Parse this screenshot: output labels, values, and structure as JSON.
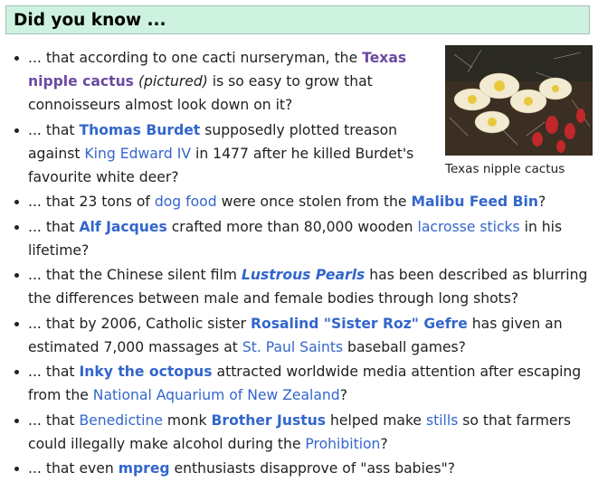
{
  "section": {
    "title": "Did you know ..."
  },
  "figure": {
    "caption": "Texas nipple cactus",
    "icon": "cactus-photo-image"
  },
  "hooks": [
    {
      "parts": [
        {
          "t": "... that according to one cacti nurseryman, the "
        },
        {
          "t": "Texas nipple cactus",
          "link": true,
          "bold": true,
          "visited": true
        },
        {
          "t": " "
        },
        {
          "t": "(pictured)",
          "italic": true
        },
        {
          "t": " is so easy to grow that connoisseurs almost look down on it?"
        }
      ]
    },
    {
      "parts": [
        {
          "t": "... that "
        },
        {
          "t": "Thomas Burdet",
          "link": true,
          "bold": true
        },
        {
          "t": " supposedly plotted treason against "
        },
        {
          "t": "King Edward IV",
          "link": true
        },
        {
          "t": " in 1477 after he killed Burdet's favourite white deer?"
        }
      ]
    },
    {
      "parts": [
        {
          "t": "... that 23 tons of "
        },
        {
          "t": "dog food",
          "link": true
        },
        {
          "t": " were once stolen from the "
        },
        {
          "t": "Malibu Feed Bin",
          "link": true,
          "bold": true
        },
        {
          "t": "?"
        }
      ]
    },
    {
      "parts": [
        {
          "t": "... that "
        },
        {
          "t": "Alf Jacques",
          "link": true,
          "bold": true
        },
        {
          "t": " crafted more than 80,000 wooden "
        },
        {
          "t": "lacrosse sticks",
          "link": true
        },
        {
          "t": " in his lifetime?"
        }
      ]
    },
    {
      "parts": [
        {
          "t": "... that the Chinese silent film "
        },
        {
          "t": "Lustrous Pearls",
          "link": true,
          "bold": true,
          "italic": true
        },
        {
          "t": " has been described as blurring the differences between male and female bodies through long shots?"
        }
      ]
    },
    {
      "parts": [
        {
          "t": "... that by 2006, Catholic sister "
        },
        {
          "t": "Rosalind \"Sister Roz\" Gefre",
          "link": true,
          "bold": true
        },
        {
          "t": " has given an estimated 7,000 massages at "
        },
        {
          "t": "St. Paul Saints",
          "link": true
        },
        {
          "t": " baseball games?"
        }
      ]
    },
    {
      "parts": [
        {
          "t": "... that "
        },
        {
          "t": "Inky the octopus",
          "link": true,
          "bold": true
        },
        {
          "t": " attracted worldwide media attention after escaping from the "
        },
        {
          "t": "National Aquarium of New Zealand",
          "link": true
        },
        {
          "t": "?"
        }
      ]
    },
    {
      "parts": [
        {
          "t": "... that "
        },
        {
          "t": "Benedictine",
          "link": true
        },
        {
          "t": " monk "
        },
        {
          "t": "Brother Justus",
          "link": true,
          "bold": true
        },
        {
          "t": " helped make "
        },
        {
          "t": "stills",
          "link": true
        },
        {
          "t": " so that farmers could illegally make alcohol during the "
        },
        {
          "t": "Prohibition",
          "link": true
        },
        {
          "t": "?"
        }
      ]
    },
    {
      "parts": [
        {
          "t": "... that even "
        },
        {
          "t": "mpreg",
          "link": true,
          "bold": true
        },
        {
          "t": " enthusiasts disapprove of \"ass babies\"?"
        }
      ]
    }
  ]
}
